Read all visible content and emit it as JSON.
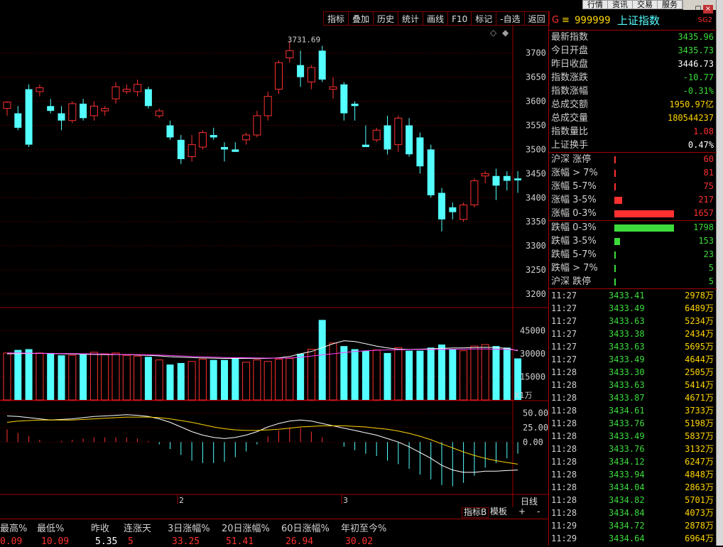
{
  "top_menu": [
    "行情",
    "资讯",
    "交易",
    "服务"
  ],
  "toolbar": [
    "指标",
    "叠加",
    "历史",
    "统计",
    "画线",
    "F10",
    "标记",
    "-自选",
    "返回"
  ],
  "header": {
    "g": "G",
    "menu_icon": "≡",
    "code": "999999",
    "name": "上证指数",
    "sg": "SG2"
  },
  "index_info": [
    {
      "label": "最新指数",
      "value": "3435.96",
      "color": "#3cdc3c"
    },
    {
      "label": "今日开盘",
      "value": "3435.73",
      "color": "#3cdc3c"
    },
    {
      "label": "昨日收盘",
      "value": "3446.73",
      "color": "#ffffff"
    },
    {
      "label": "指数涨跌",
      "value": "-10.77",
      "color": "#3cdc3c"
    },
    {
      "label": "指数涨幅",
      "value": "-0.31%",
      "color": "#3cdc3c"
    },
    {
      "label": "总成交额",
      "value": "1950.97亿",
      "color": "#ffd400"
    },
    {
      "label": "总成交量",
      "value": "180544237",
      "color": "#ffd400"
    },
    {
      "label": "指数量比",
      "value": "1.08",
      "color": "#ff3030"
    },
    {
      "label": "上证换手",
      "value": "0.47%",
      "color": "#ffffff"
    }
  ],
  "rise_dist": [
    {
      "label": "沪深 涨停",
      "value": "60",
      "bar": 0.02
    },
    {
      "label": "涨幅 > 7%",
      "value": "81",
      "bar": 0.02
    },
    {
      "label": "涨幅 5-7%",
      "value": "75",
      "bar": 0.02
    },
    {
      "label": "涨幅 3-5%",
      "value": "217",
      "bar": 0.13
    },
    {
      "label": "涨幅 0-3%",
      "value": "1657",
      "bar": 1.0
    }
  ],
  "fall_dist": [
    {
      "label": "跌幅 0-3%",
      "value": "1798",
      "bar": 1.0
    },
    {
      "label": "跌幅 3-5%",
      "value": "153",
      "bar": 0.09
    },
    {
      "label": "跌幅 5-7%",
      "value": "23",
      "bar": 0.01
    },
    {
      "label": "跌幅 > 7%",
      "value": "5",
      "bar": 0.01
    },
    {
      "label": "沪深 跌停",
      "value": "5",
      "bar": 0.01
    }
  ],
  "ticks": [
    [
      "11:27",
      "3433.41",
      "2978万"
    ],
    [
      "11:27",
      "3433.49",
      "6489万"
    ],
    [
      "11:27",
      "3433.63",
      "5234万"
    ],
    [
      "11:27",
      "3433.38",
      "2434万"
    ],
    [
      "11:27",
      "3433.63",
      "5695万"
    ],
    [
      "11:27",
      "3433.49",
      "4644万"
    ],
    [
      "11:28",
      "3433.30",
      "2505万"
    ],
    [
      "11:28",
      "3433.63",
      "5414万"
    ],
    [
      "11:28",
      "3433.87",
      "4671万"
    ],
    [
      "11:28",
      "3434.61",
      "3733万"
    ],
    [
      "11:28",
      "3433.76",
      "5198万"
    ],
    [
      "11:28",
      "3433.49",
      "5837万"
    ],
    [
      "11:28",
      "3433.76",
      "3132万"
    ],
    [
      "11:28",
      "3434.12",
      "6247万"
    ],
    [
      "11:28",
      "3433.94",
      "4848万"
    ],
    [
      "11:28",
      "3434.04",
      "2863万"
    ],
    [
      "11:28",
      "3434.82",
      "5701万"
    ],
    [
      "11:28",
      "3434.84",
      "4073万"
    ],
    [
      "11:29",
      "3434.72",
      "2878万"
    ],
    [
      "11:29",
      "3434.64",
      "6964万"
    ]
  ],
  "stats": {
    "headers": [
      "最高%",
      "最低%",
      "昨收",
      "连涨天",
      "3日涨幅%",
      "20日涨幅%",
      "60日涨幅%",
      "年初至今%"
    ],
    "values": [
      "0.09",
      "10.09",
      "5.35",
      "5",
      "33.25",
      "51.41",
      "26.94",
      "30.02"
    ],
    "colors": [
      "#ff3030",
      "#ff3030",
      "#ffffff",
      "#ff3030",
      "#ff3030",
      "#ff3030",
      "#ff3030",
      "#ff3030"
    ]
  },
  "bottom": {
    "tab1": "指标B",
    "tab2": "模板",
    "plus": "+",
    "minus": "-",
    "period": "日线",
    "volunit": "X1万"
  },
  "chart_data": {
    "type": "candlestick",
    "high_label": "3731.69",
    "price_ticks": [
      "3700",
      "3650",
      "3600",
      "3550",
      "3500",
      "3450",
      "3400",
      "3350",
      "3300",
      "3250",
      "3200"
    ],
    "vol_ticks": [
      "45000",
      "30000",
      "15000"
    ],
    "macd_ticks": [
      "50.00",
      "25.00",
      "0.00"
    ],
    "month_labels": [
      "2",
      "3"
    ],
    "colors": {
      "up": "#ff3030",
      "down": "#54ffff",
      "ma_white": "#ffffff",
      "ma_yellow": "#ffd400",
      "ma_pink": "#ff40ff"
    },
    "candles": [
      [
        3585,
        3600,
        3570,
        3598
      ],
      [
        3575,
        3590,
        3540,
        3545
      ],
      [
        3625,
        3635,
        3505,
        3510
      ],
      [
        3620,
        3635,
        3610,
        3628
      ],
      [
        3590,
        3605,
        3575,
        3580
      ],
      [
        3575,
        3590,
        3540,
        3560
      ],
      [
        3560,
        3600,
        3555,
        3595
      ],
      [
        3595,
        3605,
        3560,
        3565
      ],
      [
        3570,
        3600,
        3560,
        3590
      ],
      [
        3580,
        3590,
        3570,
        3585
      ],
      [
        3605,
        3640,
        3595,
        3630
      ],
      [
        3620,
        3635,
        3615,
        3625
      ],
      [
        3620,
        3645,
        3610,
        3635
      ],
      [
        3625,
        3630,
        3585,
        3590
      ],
      [
        3570,
        3585,
        3565,
        3580
      ],
      [
        3550,
        3560,
        3520,
        3525
      ],
      [
        3520,
        3530,
        3470,
        3480
      ],
      [
        3485,
        3530,
        3475,
        3510
      ],
      [
        3505,
        3540,
        3500,
        3535
      ],
      [
        3530,
        3545,
        3520,
        3525
      ],
      [
        3505,
        3515,
        3475,
        3500
      ],
      [
        3500,
        3515,
        3495,
        3495
      ],
      [
        3520,
        3535,
        3510,
        3530
      ],
      [
        3530,
        3580,
        3525,
        3570
      ],
      [
        3570,
        3620,
        3560,
        3610
      ],
      [
        3625,
        3685,
        3615,
        3680
      ],
      [
        3690,
        3725,
        3680,
        3705
      ],
      [
        3675,
        3705,
        3630,
        3650
      ],
      [
        3640,
        3675,
        3625,
        3670
      ],
      [
        3705,
        3715,
        3640,
        3645
      ],
      [
        3625,
        3650,
        3605,
        3630
      ],
      [
        3635,
        3640,
        3560,
        3575
      ],
      [
        3595,
        3600,
        3560,
        3590
      ],
      [
        3510,
        3550,
        3505,
        3505
      ],
      [
        3520,
        3545,
        3515,
        3540
      ],
      [
        3550,
        3570,
        3490,
        3500
      ],
      [
        3510,
        3570,
        3495,
        3565
      ],
      [
        3550,
        3565,
        3485,
        3490
      ],
      [
        3525,
        3535,
        3450,
        3465
      ],
      [
        3500,
        3510,
        3400,
        3405
      ],
      [
        3410,
        3420,
        3330,
        3355
      ],
      [
        3380,
        3390,
        3355,
        3370
      ],
      [
        3355,
        3390,
        3350,
        3385
      ],
      [
        3385,
        3440,
        3380,
        3435
      ],
      [
        3445,
        3455,
        3430,
        3450
      ],
      [
        3445,
        3460,
        3395,
        3425
      ],
      [
        3445,
        3455,
        3415,
        3435
      ],
      [
        3440,
        3455,
        3410,
        3436
      ]
    ],
    "volume": [
      30500,
      32500,
      33000,
      30500,
      30000,
      29000,
      29000,
      30000,
      31000,
      30000,
      30500,
      29000,
      28500,
      28000,
      26000,
      23000,
      24000,
      25000,
      26500,
      26000,
      26000,
      27000,
      24500,
      26000,
      25000,
      26500,
      27000,
      30000,
      33000,
      52000,
      37000,
      35000,
      33000,
      32000,
      32500,
      30500,
      34000,
      32000,
      32000,
      34000,
      36000,
      33000,
      32000,
      35000,
      36000,
      35000,
      34000,
      27000
    ],
    "ma_white": [
      30000,
      30100,
      30200,
      30300,
      30200,
      30000,
      29800,
      29700,
      29600,
      29500,
      29500,
      29400,
      29200,
      29000,
      28600,
      28100,
      27800,
      27500,
      27300,
      27200,
      27000,
      27000,
      27000,
      26900,
      27000,
      27400,
      28200,
      30000,
      31500,
      34000,
      36500,
      38500,
      38000,
      36500,
      35000,
      33800,
      33000,
      32800,
      33000,
      33200,
      33500,
      33800,
      33800,
      34000,
      34200,
      34000,
      33500,
      32000
    ],
    "ma_pink": [
      30500,
      30500,
      30400,
      30300,
      30300,
      30200,
      30100,
      30000,
      29900,
      29800,
      29600,
      29500,
      29400,
      29300,
      29100,
      28900,
      28600,
      28300,
      28000,
      27800,
      27600,
      27500,
      27400,
      27300,
      27200,
      27200,
      27300,
      27700,
      28500,
      29300,
      30000,
      30800,
      31500,
      32000,
      32300,
      32500,
      32600,
      32700,
      32800,
      32800,
      32900,
      33000,
      33000,
      33100,
      33100,
      33000,
      32900,
      32300
    ],
    "macd_dif": [
      45,
      44,
      42,
      40,
      38,
      39,
      40,
      42,
      44,
      45,
      46,
      47,
      46,
      44,
      40,
      34,
      26,
      18,
      12,
      8,
      6,
      8,
      12,
      18,
      26,
      32,
      36,
      38,
      36,
      32,
      28,
      24,
      20,
      16,
      12,
      6,
      0,
      -8,
      -18,
      -28,
      -40,
      -48,
      -52,
      -52,
      -50,
      -50,
      -49,
      -48
    ],
    "macd_dea": [
      34,
      36,
      37,
      38,
      38,
      38,
      38,
      39,
      40,
      41,
      42,
      43,
      43,
      43,
      42,
      40,
      37,
      34,
      30,
      26,
      23,
      21,
      20,
      20,
      21,
      22,
      24,
      26,
      27,
      28,
      28,
      28,
      27,
      26,
      24,
      22,
      19,
      15,
      10,
      4,
      -3,
      -10,
      -17,
      -23,
      -28,
      -32,
      -35,
      -38
    ],
    "macd_hist": [
      22,
      16,
      10,
      4,
      0,
      2,
      4,
      6,
      8,
      8,
      8,
      8,
      6,
      2,
      -4,
      -12,
      -22,
      -32,
      -36,
      -36,
      -34,
      -26,
      -16,
      -4,
      10,
      20,
      24,
      24,
      18,
      8,
      0,
      -8,
      -14,
      -20,
      -24,
      -32,
      -38,
      -46,
      -56,
      -64,
      -74,
      -76,
      -70,
      -58,
      -44,
      -36,
      -28,
      -20
    ]
  }
}
